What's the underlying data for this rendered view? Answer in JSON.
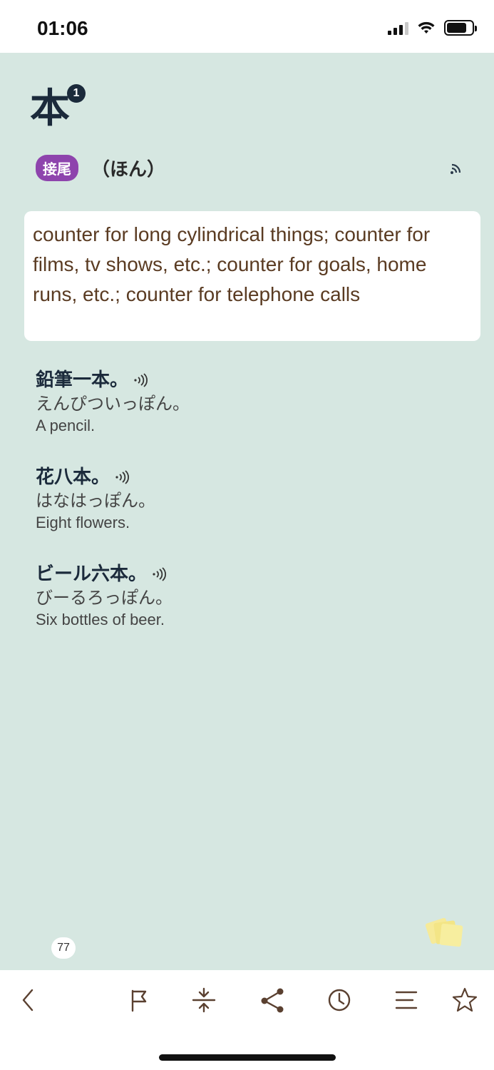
{
  "status": {
    "time": "01:06"
  },
  "entry": {
    "headword": "本",
    "sense_number": "1",
    "pos": "接尾",
    "reading": "（ほん）",
    "definition": "counter for long cylindrical things; counter for films, tv shows, etc.; counter for goals, home runs, etc.; counter for telephone calls"
  },
  "examples": [
    {
      "jp": "鉛筆一本。",
      "kana": "えんぴついっぽん。",
      "en": "A pencil."
    },
    {
      "jp": "花八本。",
      "kana": "はなはっぽん。",
      "en": "Eight flowers."
    },
    {
      "jp": "ビール六本。",
      "kana": "びーるろっぽん。",
      "en": "Six bottles of beer."
    }
  ],
  "page_count": "77",
  "colors": {
    "background": "#d6e7e1",
    "pos_badge": "#8e44ad",
    "definition_text": "#5a3b22",
    "icon": "#5a4030"
  },
  "toolbar": {
    "icons": [
      "chevron-left-icon",
      "flag-icon",
      "compress-icon",
      "share-icon",
      "clock-icon",
      "list-icon",
      "star-icon"
    ]
  }
}
